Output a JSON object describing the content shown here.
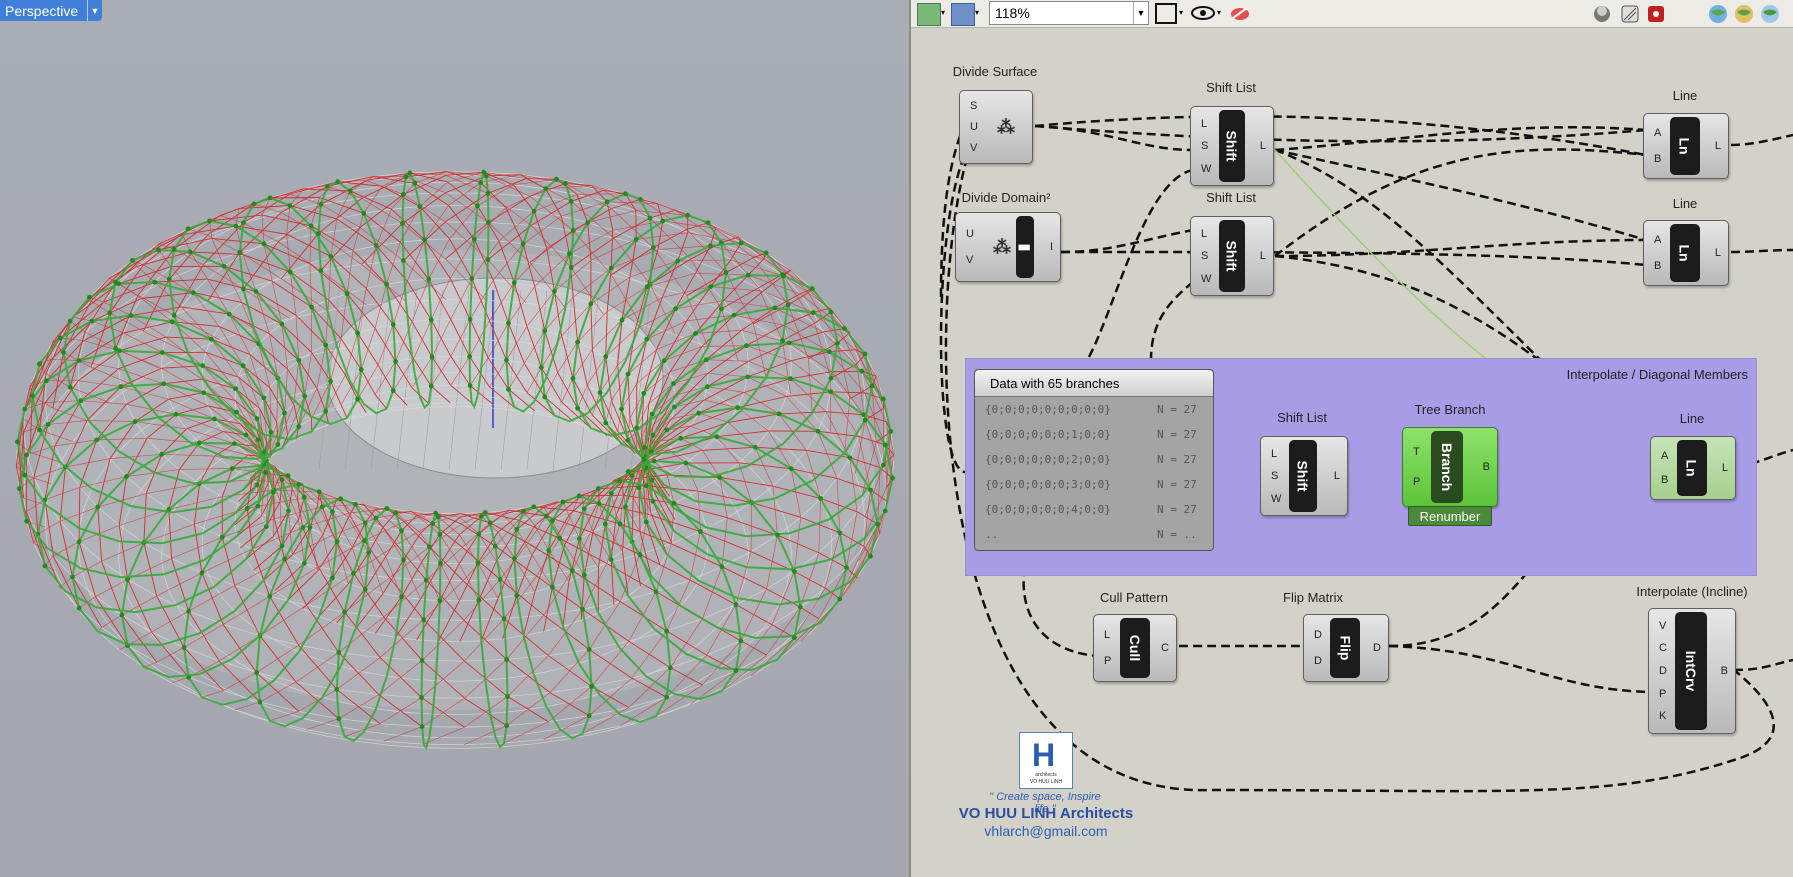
{
  "viewport": {
    "tab_label": "Perspective"
  },
  "toolbar": {
    "zoom_value": "118%"
  },
  "components": {
    "divide_surface": {
      "title": "Divide Surface",
      "inputs": [
        "S",
        "U",
        "V"
      ],
      "outputs": []
    },
    "shift_list_1": {
      "title": "Shift List",
      "core": "Shift",
      "inputs": [
        "L",
        "S",
        "W"
      ],
      "outputs": [
        "L"
      ]
    },
    "line_1": {
      "title": "Line",
      "core": "Ln",
      "inputs": [
        "A",
        "B"
      ],
      "outputs": [
        "L"
      ]
    },
    "divide_domain": {
      "title": "Divide Domain²",
      "inputs": [
        "U",
        "V"
      ],
      "outputs": [
        "I"
      ]
    },
    "shift_list_2": {
      "title": "Shift List",
      "core": "Shift",
      "inputs": [
        "L",
        "S",
        "W"
      ],
      "outputs": [
        "L"
      ]
    },
    "line_2": {
      "title": "Line",
      "core": "Ln",
      "inputs": [
        "A",
        "B"
      ],
      "outputs": [
        "L"
      ]
    },
    "shift_list_3": {
      "title": "Shift List",
      "core": "Shift",
      "inputs": [
        "L",
        "S",
        "W"
      ],
      "outputs": [
        "L"
      ]
    },
    "tree_branch": {
      "title": "Tree Branch",
      "core": "Branch",
      "inputs": [
        "T",
        "P"
      ],
      "outputs": [
        "B"
      ],
      "label": "Renumber"
    },
    "line_3": {
      "title": "Line",
      "core": "Ln",
      "inputs": [
        "A",
        "B"
      ],
      "outputs": [
        "L"
      ]
    },
    "cull_pattern": {
      "title": "Cull Pattern",
      "core": "Cull",
      "inputs": [
        "L",
        "P"
      ],
      "outputs": [
        "C"
      ]
    },
    "flip_matrix": {
      "title": "Flip Matrix",
      "core": "Flip",
      "inputs": [
        "D",
        "D"
      ],
      "outputs": [
        "D"
      ]
    },
    "interpolate_incline": {
      "title": "Interpolate (Incline)",
      "core": "IntCrv",
      "inputs": [
        "V",
        "C",
        "D",
        "P",
        "K"
      ],
      "outputs": [
        "B"
      ]
    }
  },
  "group": {
    "label": "Interpolate / Diagonal Members",
    "color": "#a99ce6"
  },
  "panel": {
    "title": "Data with 65 branches",
    "rows": [
      {
        "path": "{0;0;0;0;0;0;0;0;0}",
        "count": "N = 27"
      },
      {
        "path": "{0;0;0;0;0;0;1;0;0}",
        "count": "N = 27"
      },
      {
        "path": "{0;0;0;0;0;0;2;0;0}",
        "count": "N = 27"
      },
      {
        "path": "{0;0;0;0;0;0;3;0;0}",
        "count": "N = 27"
      },
      {
        "path": "{0;0;0;0;0;0;4;0;0}",
        "count": "N = 27"
      },
      {
        "path": "..",
        "count": "N = .."
      }
    ]
  },
  "branding": {
    "logo_letter": "H",
    "logo_line1": "architects",
    "logo_line2": "VO HUU LINH",
    "tagline": "\" Create space, Inspire life \"",
    "firm": "VO HUU LINH Architects",
    "email": "vhlarch@gmail.com"
  },
  "colors": {
    "accent": "#3f7fd9",
    "green_nodes": "#2e9a2e",
    "red_members": "#d03030",
    "tree_branch": "#6fd24a"
  }
}
